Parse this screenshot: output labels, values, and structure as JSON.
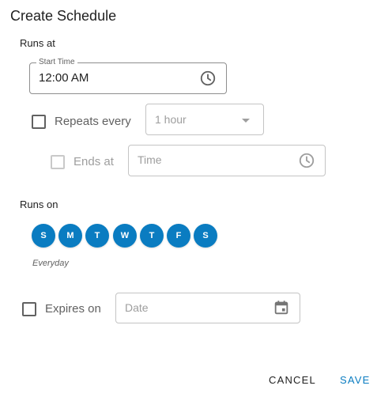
{
  "dialog": {
    "title": "Create Schedule"
  },
  "runs_at": {
    "label": "Runs at",
    "start_time": {
      "legend": "Start Time",
      "value": "12:00 AM",
      "icon": "clock-icon"
    }
  },
  "repeats": {
    "label": "Repeats every",
    "checked": false,
    "interval": {
      "value": "1 hour",
      "options_visible": [
        "1 hour"
      ]
    }
  },
  "ends": {
    "label": "Ends at",
    "checked": false,
    "time_placeholder": "Time",
    "icon": "clock-icon"
  },
  "runs_on": {
    "label": "Runs on",
    "days": [
      {
        "letter": "S",
        "selected": true
      },
      {
        "letter": "M",
        "selected": true
      },
      {
        "letter": "T",
        "selected": true
      },
      {
        "letter": "W",
        "selected": true
      },
      {
        "letter": "T",
        "selected": true
      },
      {
        "letter": "F",
        "selected": true
      },
      {
        "letter": "S",
        "selected": true
      }
    ],
    "summary": "Everyday"
  },
  "expires": {
    "label": "Expires on",
    "checked": false,
    "date_placeholder": "Date",
    "icon": "calendar-icon"
  },
  "actions": {
    "cancel_label": "CANCEL",
    "save_label": "SAVE"
  },
  "colors": {
    "accent": "#0a7cc1",
    "text": "#212121",
    "muted": "#9e9e9e"
  }
}
